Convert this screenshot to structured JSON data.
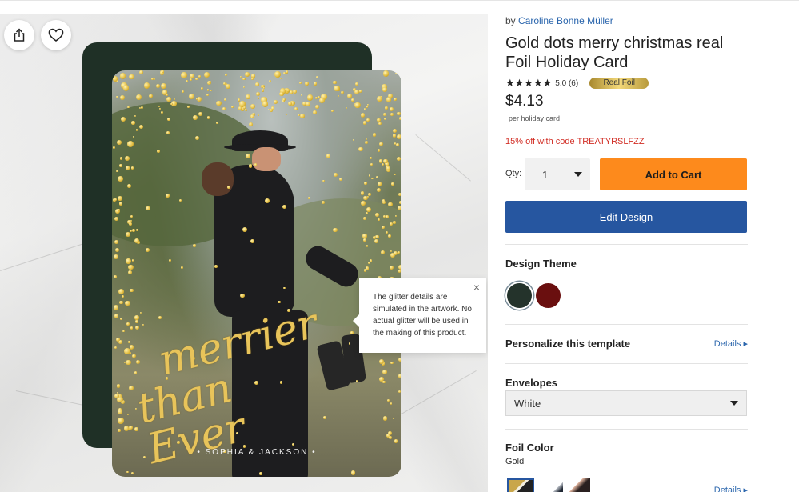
{
  "preview": {
    "share_icon": "share-icon",
    "favorite_icon": "heart-icon",
    "card": {
      "script_line1": "merrier",
      "script_line2": "than Ever",
      "names": "• SOPHIA & JACKSON •"
    },
    "tooltip": {
      "text": "The glitter details are simulated in the artwork. No actual glitter will be used in the making of this product.",
      "close": "×"
    }
  },
  "product": {
    "by_prefix": "by",
    "designer": "Caroline Bonne Müller",
    "title": "Gold dots merry christmas real Foil Holiday Card",
    "stars": "★★★★★",
    "rating": "5.0 (6)",
    "foil_badge": "Real Foil",
    "price": "$4.13",
    "per_unit": "per holiday card",
    "promo": "15% off with code TREATYRSLFZZ",
    "qty_label": "Qty:",
    "qty_value": "1",
    "add_to_cart": "Add to Cart",
    "edit_design": "Edit Design",
    "design_theme_title": "Design Theme",
    "theme_swatches": [
      {
        "name": "dark green",
        "color": "#24332b",
        "selected": true
      },
      {
        "name": "burgundy",
        "color": "#6a0f0f",
        "selected": false
      }
    ],
    "personalize_title": "Personalize this template",
    "details_link": "Details ▸",
    "envelopes_title": "Envelopes",
    "envelope_value": "White",
    "foil_color_title": "Foil Color",
    "foil_color_value": "Gold",
    "foil_details_link": "Details ▸"
  },
  "colors": {
    "accent_orange": "#fd8a1c",
    "accent_blue": "#2656a0",
    "link_blue": "#2b66ad",
    "promo_red": "#d22f26",
    "gold": "#e8c45a"
  }
}
